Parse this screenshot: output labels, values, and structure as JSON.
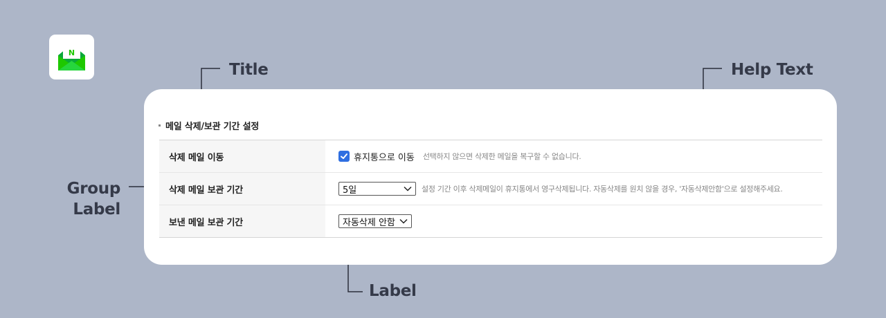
{
  "callouts": {
    "title": "Title",
    "help_text": "Help Text",
    "group_label_line1": "Group",
    "group_label_line2": "Label",
    "label": "Label"
  },
  "app_icon": {
    "letter": "N",
    "icon": "mail-envelope-icon",
    "color": "#1ec800"
  },
  "section": {
    "title": "메일 삭제/보관 기간 설정",
    "rows": [
      {
        "label": "삭제 메일 이동",
        "checkbox_label": "휴지통으로 이동",
        "checked": true,
        "help": "선택하지 않으면 삭제한 메일을 복구할 수 없습니다."
      },
      {
        "label": "삭제 메일 보관 기간",
        "select_value": "5일",
        "help": "설정 기간 이후 삭제메일이 휴지통에서 영구삭제됩니다. 자동삭제를 원치 않을 경우, '자동삭제안함'으로 설정해주세요."
      },
      {
        "label": "보낸 메일 보관 기간",
        "select_value": "자동삭제 안함"
      }
    ]
  },
  "colors": {
    "background": "#adb6c8",
    "checkbox": "#2f6fe1",
    "callout_text": "#353a49"
  }
}
